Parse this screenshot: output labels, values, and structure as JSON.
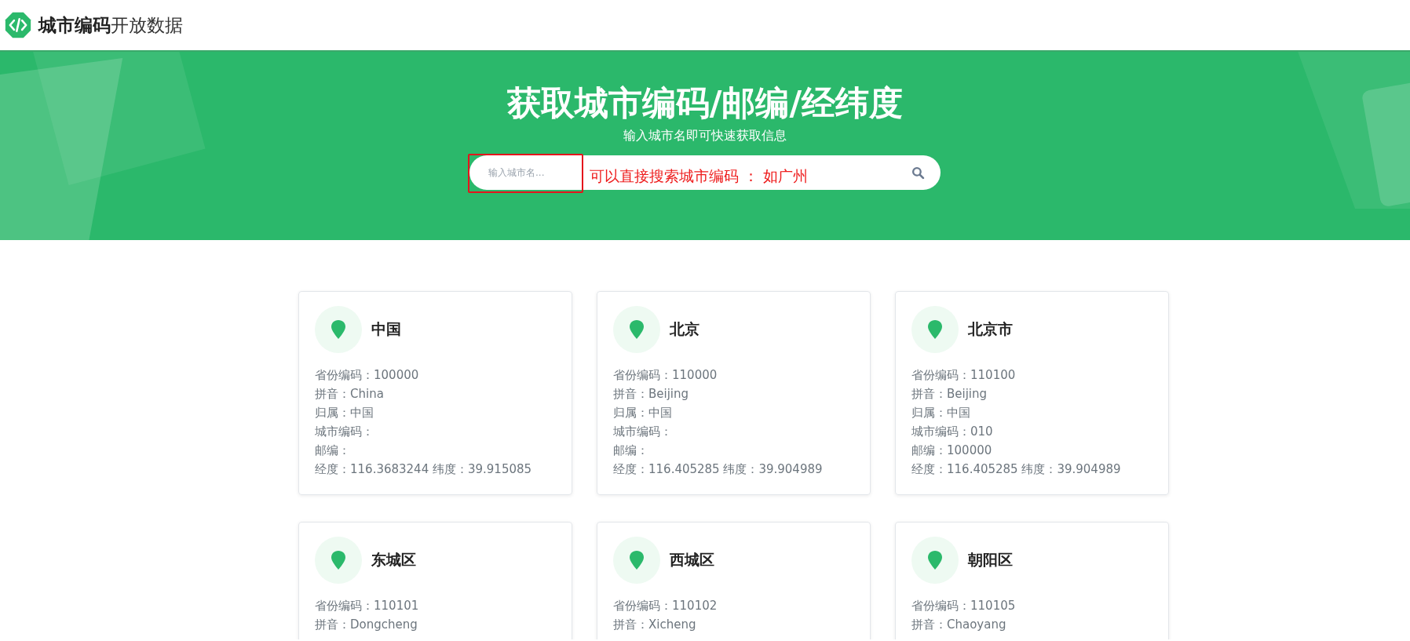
{
  "header": {
    "brand_bold": "城市编码",
    "brand_light": "开放数据"
  },
  "hero": {
    "title": "获取城市编码/邮编/经纬度",
    "subtitle": "输入城市名即可快速获取信息",
    "search": {
      "placeholder": "输入城市名..."
    },
    "annotation": "可以直接搜索城市编码 ： 如广州"
  },
  "cards": [
    {
      "name": "中国",
      "lines": [
        "省份编码：100000",
        "拼音：China",
        "归属：中国",
        "城市编码：",
        "邮编：",
        "经度：116.3683244 纬度：39.915085"
      ]
    },
    {
      "name": "北京",
      "lines": [
        "省份编码：110000",
        "拼音：Beijing",
        "归属：中国",
        "城市编码：",
        "邮编：",
        "经度：116.405285 纬度：39.904989"
      ]
    },
    {
      "name": "北京市",
      "lines": [
        "省份编码：110100",
        "拼音：Beijing",
        "归属：中国",
        "城市编码：010",
        "邮编：100000",
        "经度：116.405285 纬度：39.904989"
      ]
    },
    {
      "name": "东城区",
      "lines": [
        "省份编码：110101",
        "拼音：Dongcheng"
      ]
    },
    {
      "name": "西城区",
      "lines": [
        "省份编码：110102",
        "拼音：Xicheng"
      ]
    },
    {
      "name": "朝阳区",
      "lines": [
        "省份编码：110105",
        "拼音：Chaoyang"
      ]
    }
  ]
}
